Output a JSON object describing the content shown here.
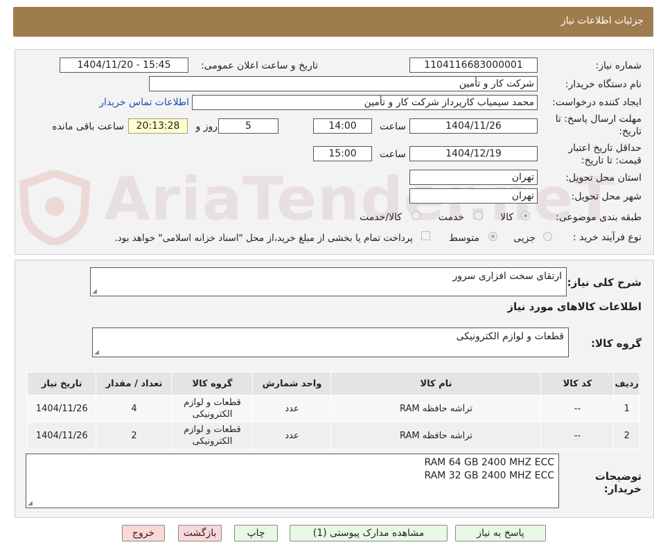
{
  "header": {
    "title": "جزئیات اطلاعات نیاز"
  },
  "watermark": "AriaTender.neT",
  "fields": {
    "need_number_label": "شماره نیاز:",
    "need_number": "1104116683000001",
    "announce_label": "تاریخ و ساعت اعلان عمومی:",
    "announce_value": "1404/11/20 - 15:45",
    "buyer_org_label": "نام دستگاه خریدار:",
    "buyer_org": "شرکت کار و تأمین",
    "creator_label": "ایجاد کننده درخواست:",
    "creator": "محمد سیمیاب کارپرداز شرکت کار و تأمین",
    "contact_link": "اطلاعات تماس خریدار",
    "deadline_label_1": "مهلت ارسال پاسخ: تا",
    "deadline_label_2": "تاریخ:",
    "deadline_date": "1404/11/26",
    "time_label": "ساعت",
    "deadline_time": "14:00",
    "days_value": "5",
    "days_label": "روز و",
    "remaining_time": "20:13:28",
    "remaining_label": "ساعت باقی مانده",
    "validity_label_1": "حداقل تاریخ اعتبار",
    "validity_label_2": "قیمت: تا تاریخ:",
    "validity_date": "1404/12/19",
    "validity_time": "15:00",
    "province_label": "استان محل تحویل:",
    "province": "تهران",
    "city_label": "شهر محل تحویل:",
    "city": "تهران",
    "category_label": "طبقه بندی موضوعی:",
    "category_options": [
      "کالا",
      "خدمت",
      "کالا/خدمت"
    ],
    "category_selected": "کالا",
    "process_label": "نوع فرآیند خرید :",
    "process_options": [
      "جزیی",
      "متوسط"
    ],
    "process_selected": "متوسط",
    "payment_note": "پرداخت تمام یا بخشی از مبلغ خرید،از محل \"اسناد خزانه اسلامی\" خواهد بود."
  },
  "summary": {
    "general_desc_label": "شرح کلی نیاز:",
    "general_desc": "ارتقای سخت افزاری سرور",
    "goods_info_title": "اطلاعات کالاهای مورد نیاز",
    "goods_group_label": "گروه کالا:",
    "goods_group": "قطعات و لوازم الکترونیکی"
  },
  "table": {
    "headers": [
      "ردیف",
      "کد کالا",
      "نام کالا",
      "واحد شمارش",
      "گروه کالا",
      "تعداد / مقدار",
      "تاریخ نیاز"
    ],
    "rows": [
      [
        "1",
        "--",
        "تراشه حافظه RAM",
        "عدد",
        "قطعات و لوازم الکترونیکی",
        "4",
        "1404/11/26"
      ],
      [
        "2",
        "--",
        "تراشه حافظه RAM",
        "عدد",
        "قطعات و لوازم الکترونیکی",
        "2",
        "1404/11/26"
      ]
    ]
  },
  "buyer_notes": {
    "label_1": "توضیحات",
    "label_2": "خریدار:",
    "line_1": "RAM 64 GB 2400 MHZ ECC",
    "line_2": "RAM 32 GB 2400 MHZ ECC"
  },
  "buttons": {
    "respond": "پاسخ به نیاز",
    "attachments": "مشاهده مدارک پیوستی (1)",
    "print": "چاپ",
    "back": "بازگشت",
    "exit": "خروج"
  },
  "colors": {
    "header_bg": "#9f7c4e",
    "button_bg": "#e9f8e4",
    "exit_bg": "#fbd7d7",
    "remaining_bg": "#ffffcc",
    "link": "#1a4fb0"
  }
}
